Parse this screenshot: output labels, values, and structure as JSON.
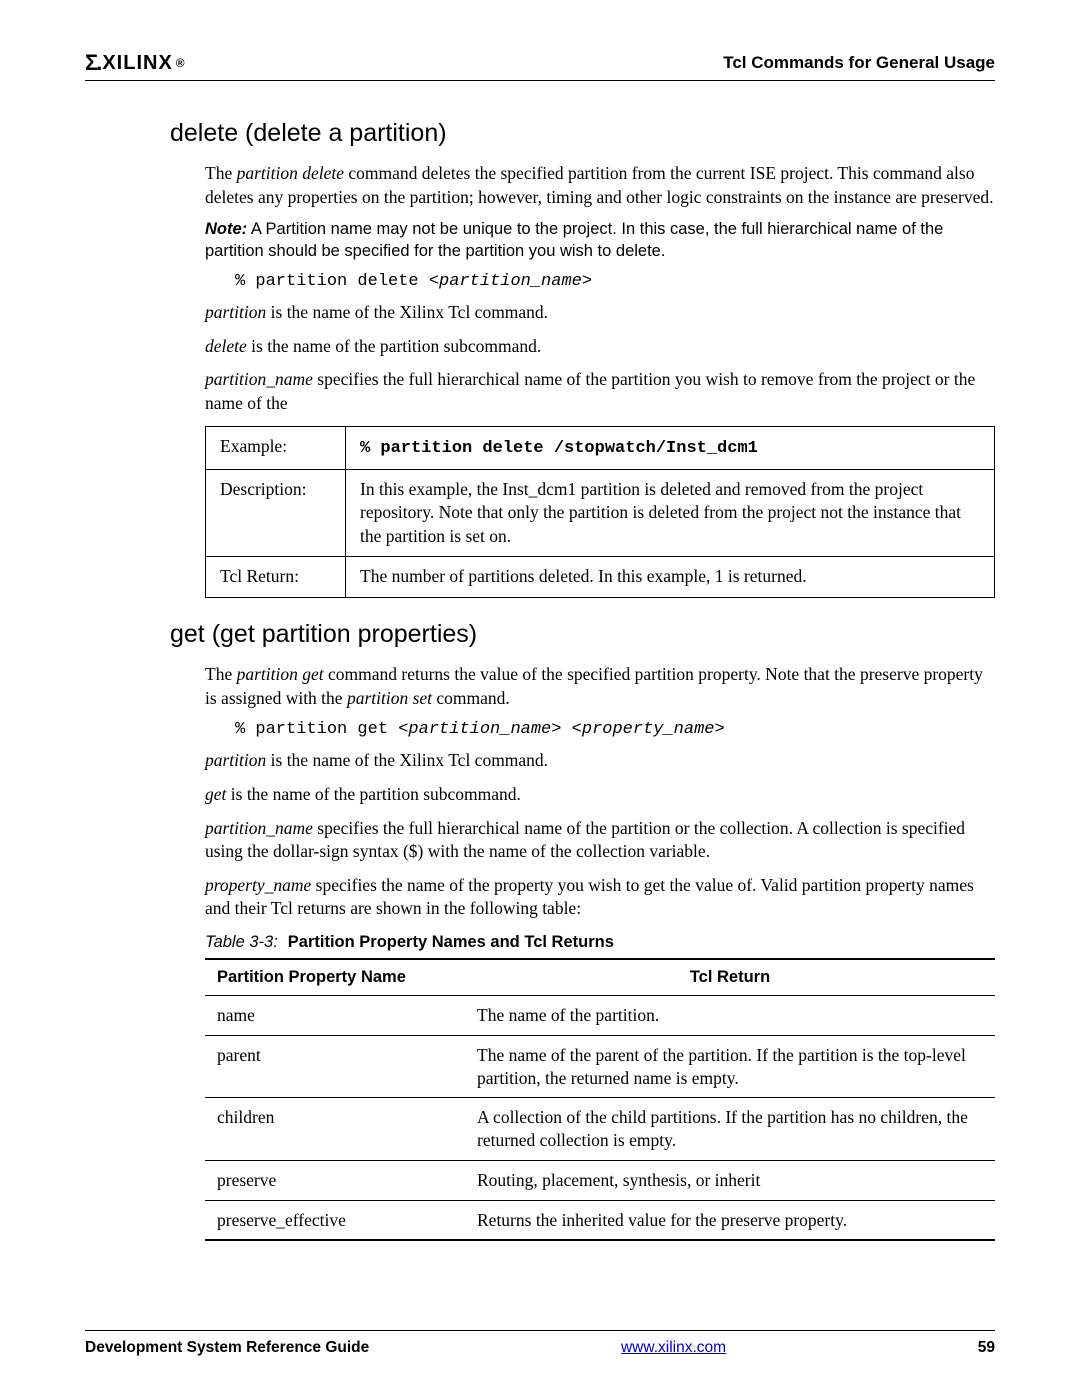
{
  "header": {
    "logo_text": "XILINX",
    "logo_reg": "®",
    "right_text": "Tcl Commands for General Usage"
  },
  "section1": {
    "heading": "delete (delete a partition)",
    "intro_html": "The <span class='ital'>partition delete</span> command deletes the specified partition from the current ISE project. This command also deletes any properties on the partition; however, timing and other logic constraints on the instance are preserved.",
    "note_html": "<span class='note-label'>Note:</span>  A Partition name may not be unique to the project. In this case, the full hierarchical name of the partition should be specified for the partition you wish to delete.",
    "code_html": "% partition delete <span class='code-arg'>&lt;partition_name&gt;</span>",
    "p1_html": "<span class='ital'>partition</span> is the name of the Xilinx Tcl command.",
    "p2_html": "<span class='ital'>delete</span> is the name of the partition subcommand.",
    "p3_html": "<span class='ital'>partition_name</span> specifies the full hierarchical name of the partition you wish to remove from the project or the name of the",
    "table": {
      "row1": {
        "label": "Example:",
        "value": "% partition delete /stopwatch/Inst_dcm1"
      },
      "row2": {
        "label": "Description:",
        "value": "In this example, the Inst_dcm1 partition is deleted and removed from the project repository. Note that only the partition is deleted from the project not the instance that the partition is set on."
      },
      "row3": {
        "label": "Tcl Return:",
        "value": "The number of partitions deleted. In this example, 1 is returned."
      }
    }
  },
  "section2": {
    "heading": "get (get partition properties)",
    "intro_html": "The <span class='ital'>partition get</span> command returns the value of the specified partition property. Note that the preserve property is assigned with the <span class='ital'>partition set</span> command.",
    "code_html": "% partition get <span class='code-arg'>&lt;partition_name&gt; &lt;property_name&gt;</span>",
    "p1_html": "<span class='ital'>partition</span> is the name of the Xilinx Tcl command.",
    "p2_html": "<span class='ital'>get</span> is the name of the partition subcommand.",
    "p3_html": "<span class='ital'>partition_name</span> specifies the full hierarchical name of the partition or the collection. A collection is specified using the dollar-sign syntax ($) with the name of the collection variable.",
    "p4_html": "<span class='ital'>property_name</span> specifies the name of the property you wish to get the value of. Valid partition property names and their Tcl returns are shown in the following table:",
    "table_caption": {
      "num": "Table 3-3:",
      "title": "Partition Property Names and Tcl Returns"
    },
    "table_headers": {
      "col1": "Partition Property Name",
      "col2": "Tcl Return"
    },
    "rows": [
      {
        "name": "name",
        "ret": "The name of the partition."
      },
      {
        "name": "parent",
        "ret": "The name of the parent of the partition. If the partition is the top-level partition, the returned name is empty."
      },
      {
        "name": "children",
        "ret": "A collection of the child partitions. If the partition has no children, the returned collection is empty."
      },
      {
        "name": "preserve",
        "ret": "Routing, placement, synthesis, or inherit"
      },
      {
        "name": "preserve_effective",
        "ret": "Returns the inherited value for the preserve property."
      }
    ]
  },
  "footer": {
    "left": "Development System Reference Guide",
    "center": "www.xilinx.com",
    "right": "59"
  }
}
